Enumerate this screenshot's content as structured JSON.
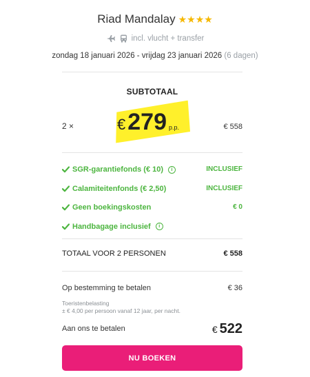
{
  "header": {
    "hotel_name": "Riad Mandalay",
    "stars": "★★★★",
    "transport_label": "incl. vlucht + transfer",
    "date_range": "zondag 18 januari 2026 - vrijdag 23 januari 2026",
    "duration": "(6 dagen)"
  },
  "subtotal": {
    "title": "SUBTOTAAL",
    "quantity": "2 ×",
    "currency": "€",
    "price_per_person": "279",
    "per_person_label": "p.p.",
    "line_total": "€ 558"
  },
  "inclusions": [
    {
      "label": "SGR-garantiefonds  (€ 10)",
      "has_info": true,
      "value": "INCLUSIEF"
    },
    {
      "label": "Calamiteitenfonds  (€ 2,50)",
      "has_info": false,
      "value": "INCLUSIEF"
    },
    {
      "label": "Geen boekingskosten",
      "has_info": false,
      "value": "€ 0"
    },
    {
      "label": "Handbagage inclusief",
      "has_info": true,
      "value": ""
    }
  ],
  "total": {
    "label": "TOTAAL VOOR 2 PERSONEN",
    "value": "€ 558"
  },
  "destination": {
    "label": "Op bestemming te betalen",
    "value": "€ 36",
    "tax_title": "Toeristenbelasting",
    "tax_detail": "± € 4,00 per persoon vanaf 12 jaar, per nacht."
  },
  "pay": {
    "label": "Aan ons te betalen",
    "currency": "€",
    "amount": "522"
  },
  "button": {
    "label": "NU BOEKEN"
  },
  "colors": {
    "accent_pink": "#ea1e78",
    "inclusion_green": "#4cb53f",
    "highlight_yellow": "#fff02b",
    "star_gold": "#f6b800"
  }
}
